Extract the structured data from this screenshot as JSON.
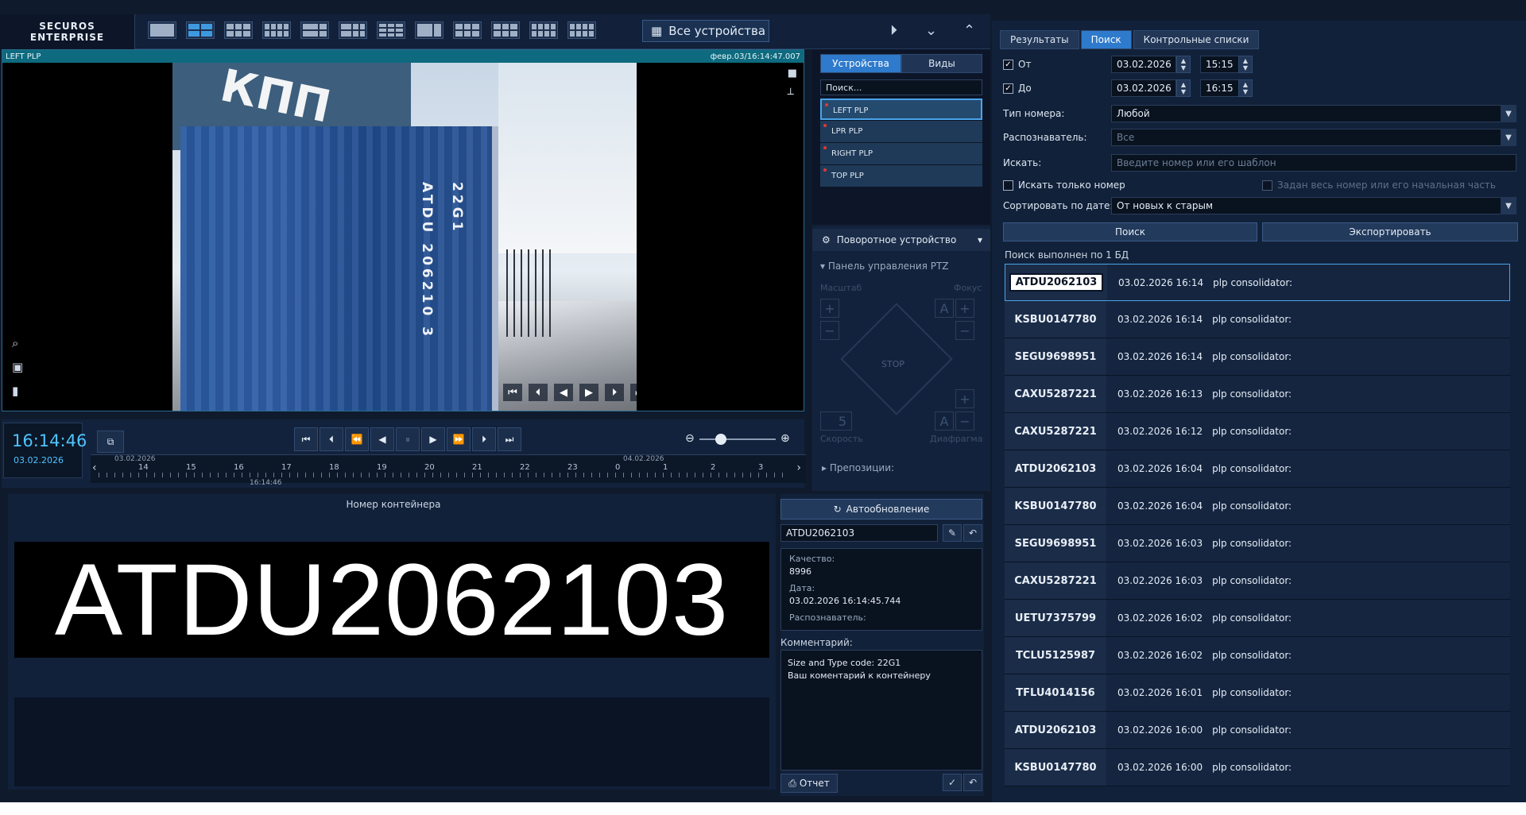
{
  "header": {
    "logo_line1": "SECUROS",
    "logo_line2": "ENTERPRISE",
    "all_devices": "Все устройства"
  },
  "camera": {
    "name": "LEFT PLP",
    "timestamp": "февр.03/16:14:47.007",
    "container_vertical": "ATDU 206210 3",
    "container_code": "22G1"
  },
  "player": {
    "time": "16:14:46",
    "date": "03.02.2026"
  },
  "timeline": {
    "date_left": "03.02.2026",
    "date_right": "04.02.2026",
    "hours": [
      "14",
      "15",
      "16",
      "17",
      "18",
      "19",
      "20",
      "21",
      "22",
      "23",
      "0",
      "1",
      "2",
      "3"
    ],
    "cursor": "16:14:46"
  },
  "devices": {
    "tabs": [
      "Устройства",
      "Виды"
    ],
    "search_placeholder": "Поиск...",
    "items": [
      "LEFT PLP",
      "LPR PLP",
      "RIGHT PLP",
      "TOP PLP"
    ]
  },
  "ptz": {
    "title": "Поворотное устройство",
    "panel": "Панель управления PTZ",
    "zoom": "Масштаб",
    "focus": "Фокус",
    "stop": "STOP",
    "speed_value": "5",
    "speed": "Скорость",
    "iris": "Диафрагма",
    "presets": "Препозиции:"
  },
  "plate_panel": {
    "label": "Номер контейнера",
    "number": "ATDU2062103"
  },
  "details": {
    "auto_update": "Автообновление",
    "number_value": "ATDU2062103",
    "quality_label": "Качество:",
    "quality_value": "8996",
    "date_label": "Дата:",
    "date_value": "03.02.2026 16:14:45.744",
    "recognizer_label": "Распознаватель:",
    "comment_label": "Комментарий:",
    "comment_line1": "Size and Type code: 22G1",
    "comment_line2": "Ваш коментарий к контейнеру",
    "report": "Отчет"
  },
  "search": {
    "tabs": [
      "Результаты",
      "Поиск",
      "Контрольные списки"
    ],
    "from_label": "От",
    "from_date": "03.02.2026",
    "from_time": "15:15",
    "to_label": "До",
    "to_date": "03.02.2026",
    "to_time": "16:15",
    "number_type_label": "Тип номера:",
    "number_type_value": "Любой",
    "recognizer_label": "Распознаватель:",
    "recognizer_value": "Все",
    "find_label": "Искать:",
    "find_placeholder": "Введите номер или его шаблон",
    "only_number": "Искать только номер",
    "whole_number": "Задан весь номер или его начальная часть",
    "sort_label": "Сортировать по дате:",
    "sort_value": "От новых к старым",
    "search_button": "Поиск",
    "export_button": "Экспортировать",
    "status": "Поиск выполнен по 1 БД"
  },
  "results": [
    {
      "number": "ATDU2062103",
      "datetime": "03.02.2026 16:14",
      "source": "plp consolidator:"
    },
    {
      "number": "KSBU0147780",
      "datetime": "03.02.2026 16:14",
      "source": "plp consolidator:"
    },
    {
      "number": "SEGU9698951",
      "datetime": "03.02.2026 16:14",
      "source": "plp consolidator:"
    },
    {
      "number": "CAXU5287221",
      "datetime": "03.02.2026 16:13",
      "source": "plp consolidator:"
    },
    {
      "number": "CAXU5287221",
      "datetime": "03.02.2026 16:12",
      "source": "plp consolidator:"
    },
    {
      "number": "ATDU2062103",
      "datetime": "03.02.2026 16:04",
      "source": "plp consolidator:"
    },
    {
      "number": "KSBU0147780",
      "datetime": "03.02.2026 16:04",
      "source": "plp consolidator:"
    },
    {
      "number": "SEGU9698951",
      "datetime": "03.02.2026 16:03",
      "source": "plp consolidator:"
    },
    {
      "number": "CAXU5287221",
      "datetime": "03.02.2026 16:03",
      "source": "plp consolidator:"
    },
    {
      "number": "UETU7375799",
      "datetime": "03.02.2026 16:02",
      "source": "plp consolidator:"
    },
    {
      "number": "TCLU5125987",
      "datetime": "03.02.2026 16:02",
      "source": "plp consolidator:"
    },
    {
      "number": "TFLU4014156",
      "datetime": "03.02.2026 16:01",
      "source": "plp consolidator:"
    },
    {
      "number": "ATDU2062103",
      "datetime": "03.02.2026 16:00",
      "source": "plp consolidator:"
    },
    {
      "number": "KSBU0147780",
      "datetime": "03.02.2026 16:00",
      "source": "plp consolidator:"
    }
  ]
}
